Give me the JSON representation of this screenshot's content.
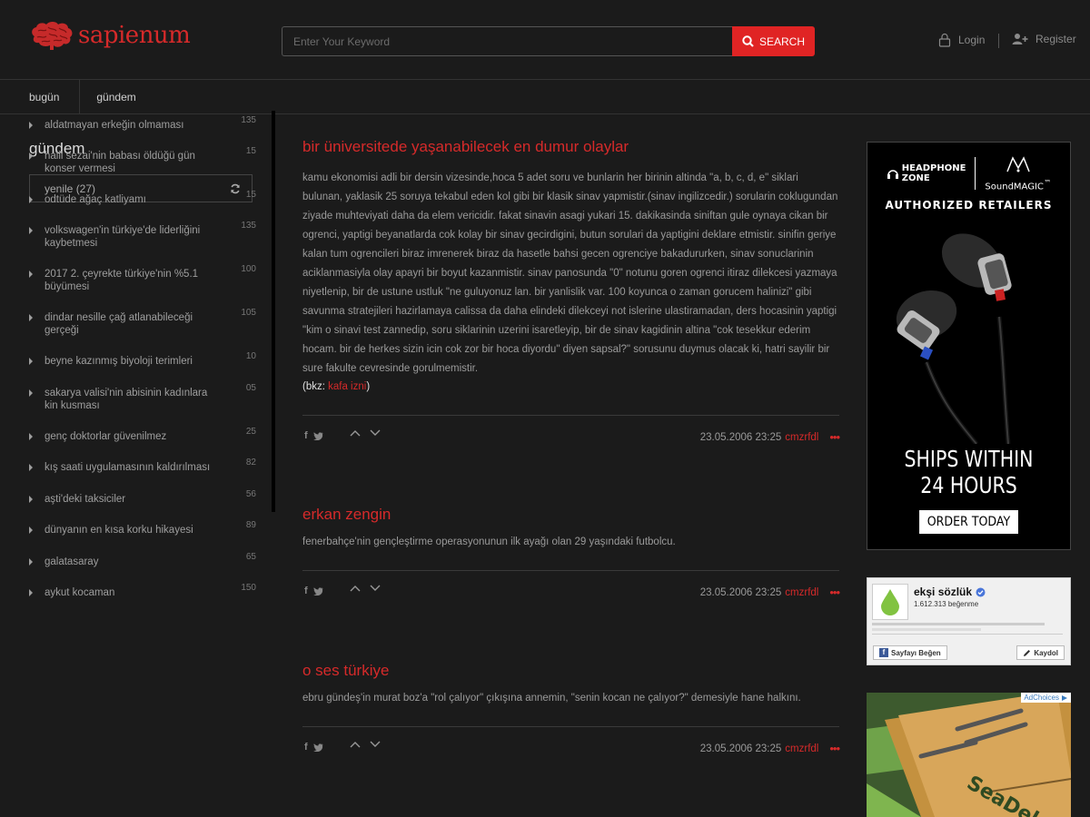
{
  "header": {
    "logo_text": "sapienum",
    "search_placeholder": "Enter Your Keyword",
    "search_button": "SEARCH",
    "login_label": "Login",
    "register_label": "Register"
  },
  "nav": {
    "tabs": [
      {
        "label": "bugün"
      },
      {
        "label": "gündem"
      }
    ]
  },
  "sidebar": {
    "title": "gündem",
    "refresh_label": "yenile (27)",
    "topics": [
      {
        "label": "aldatmayan erkeğin olmaması",
        "count": "135"
      },
      {
        "label": "halil sezai'nin babası öldüğü gün konser vermesi",
        "count": "15"
      },
      {
        "label": "odtüde ağaç katliyamı",
        "count": "15"
      },
      {
        "label": "volkswagen'in türkiye'de liderliğini kaybetmesi",
        "count": "135"
      },
      {
        "label": "2017 2. çeyrekte türkiye'nin %5.1 büyümesi",
        "count": "100"
      },
      {
        "label": "dindar nesille çağ atlanabileceği gerçeği",
        "count": "105"
      },
      {
        "label": "beyne kazınmış biyoloji terimleri",
        "count": "10"
      },
      {
        "label": "sakarya valisi'nin abisinin kadınlara kin kusması",
        "count": "05"
      },
      {
        "label": "genç doktorlar güvenilmez",
        "count": "25"
      },
      {
        "label": "kış saati uygulamasının kaldırılması",
        "count": "82"
      },
      {
        "label": "aşti'deki taksiciler",
        "count": "56"
      },
      {
        "label": "dünyanın en kısa korku hikayesi",
        "count": "89"
      },
      {
        "label": "galatasaray",
        "count": "65"
      },
      {
        "label": "aykut kocaman",
        "count": "150"
      }
    ]
  },
  "entries": [
    {
      "title": "bir üniversitede yaşanabilecek en dumur olaylar",
      "body": "kamu ekonomisi adli bir dersin vizesinde,hoca 5 adet soru ve bunlarin her birinin altinda \"a, b, c, d, e\" siklari bulunan, yaklasik 25 soruya tekabul eden kol gibi bir klasik sinav yapmistir.(sinav ingilizcedir.) sorularin coklugundan ziyade muhteviyati daha da elem vericidir. fakat sinavin asagi yukari 15. dakikasinda siniftan gule oynaya cikan bir ogrenci, yaptigi beyanatlarda cok kolay bir sinav gecirdigini, butun sorulari da yaptigini deklare etmistir. sinifin geriye kalan tum ogrencileri biraz imrenerek biraz da hasetle bahsi gecen ogrenciye bakadururken, sinav sonuclarinin aciklanmasiyla olay apayri bir boyut kazanmistir. sinav panosunda \"0\" notunu goren ogrenci itiraz dilekcesi yazmaya niyetlenip, bir de ustune ustluk \"ne guluyonuz lan. bir yanlislik var. 100 koyunca o zaman gorucem halinizi\" gibi savunma stratejileri hazirlamaya calissa da daha elindeki dilekceyi not islerine ulastiramadan, ders hocasinin yaptigi \"kim o sinavi test zannedip, soru siklarinin uzerini isaretleyip, bir de sinav kagidinin altina \"cok tesekkur ederim hocam. bir de herkes sizin icin cok zor bir hoca diyordu\" diyen sapsal?\" sorusunu duymus olacak ki, hatri sayilir bir sure fakulte cevresinde gorulmemistir.",
      "bkz_prefix": "(bkz: ",
      "bkz_link": "kafa izni",
      "bkz_suffix": ")",
      "date": "23.05.2006 23:25",
      "author": "cmzrfdl"
    },
    {
      "title": "erkan zengin",
      "body": "fenerbahçe'nin gençleştirme operasyonunun ilk ayağı olan 29 yaşındaki futbolcu.",
      "date": "23.05.2006 23:25",
      "author": "cmzrfdl"
    },
    {
      "title": "o ses türkiye",
      "body": "ebru gündeş'in murat boz'a \"rol çalıyor\" çıkışına annemin, \"senin kocan ne çalıyor?\" demesiyle hane halkını.",
      "date": "23.05.2006 23:25",
      "author": "cmzrfdl"
    }
  ],
  "more_glyph": "•••",
  "ads": {
    "headphone_brand_line1": "HEADPHONE",
    "headphone_brand_line2": "ZONE",
    "soundmagic": "SoundMAGIC",
    "tm": "™",
    "retailers": "AUTHORIZED RETAILERS",
    "ships_line1": "SHIPS WITHIN",
    "ships_line2": "24 HOURS",
    "order_button": "ORDER TODAY",
    "fb_name": "ekşi sözlük",
    "fb_likes": "1.612.313 beğenme",
    "fb_like_button": "Sayfayı Beğen",
    "fb_follow_button": "Kaydol",
    "adchoices": "AdChoices",
    "seadek_text": "SeaDek"
  },
  "colors": {
    "accent": "#d62a2a",
    "button": "#e02424",
    "background": "#1b1b1b"
  }
}
